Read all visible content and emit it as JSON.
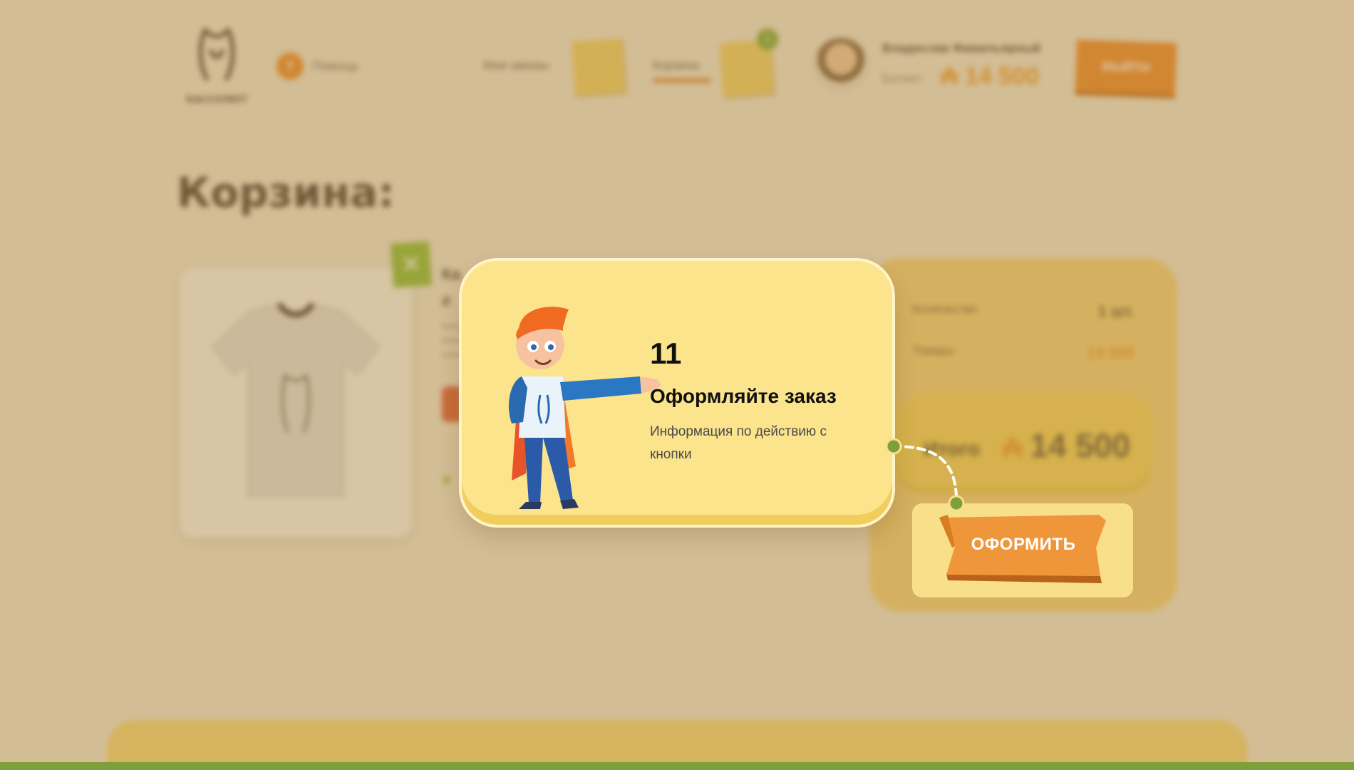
{
  "header": {
    "logo_text": "КАССОЛЮТ",
    "help_label": "Помощь",
    "nav": {
      "orders_label": "Мои заказы",
      "cart_label": "Корзина",
      "cart_badge": "1"
    },
    "user": {
      "name": "Владислав Фамильярный",
      "balance_label": "Баланс:",
      "balance_value": "14 500"
    },
    "logout_label": "ВЫЙТИ"
  },
  "cart": {
    "title": "Корзина:",
    "item": {
      "name": "Ка",
      "size": "#"
    }
  },
  "summary": {
    "quantity_label": "Количество",
    "quantity_value": "1 шт.",
    "goods_label": "Товары",
    "goods_value": "14 500",
    "total_label": "Итого",
    "total_value": "14 500",
    "checkout_label": "ОФОРМИТЬ"
  },
  "tooltip": {
    "step": "11",
    "title": "Оформляйте заказ",
    "text": "Информация по действию с кнопки"
  },
  "colors": {
    "accent_orange": "#f08a2a",
    "accent_green": "#7ea03a",
    "tooltip_bg": "#fbe48c"
  },
  "icons": [
    "logo-icon",
    "help-icon",
    "close-icon",
    "tshirt-icon",
    "character-illustration",
    "currency-icon"
  ]
}
